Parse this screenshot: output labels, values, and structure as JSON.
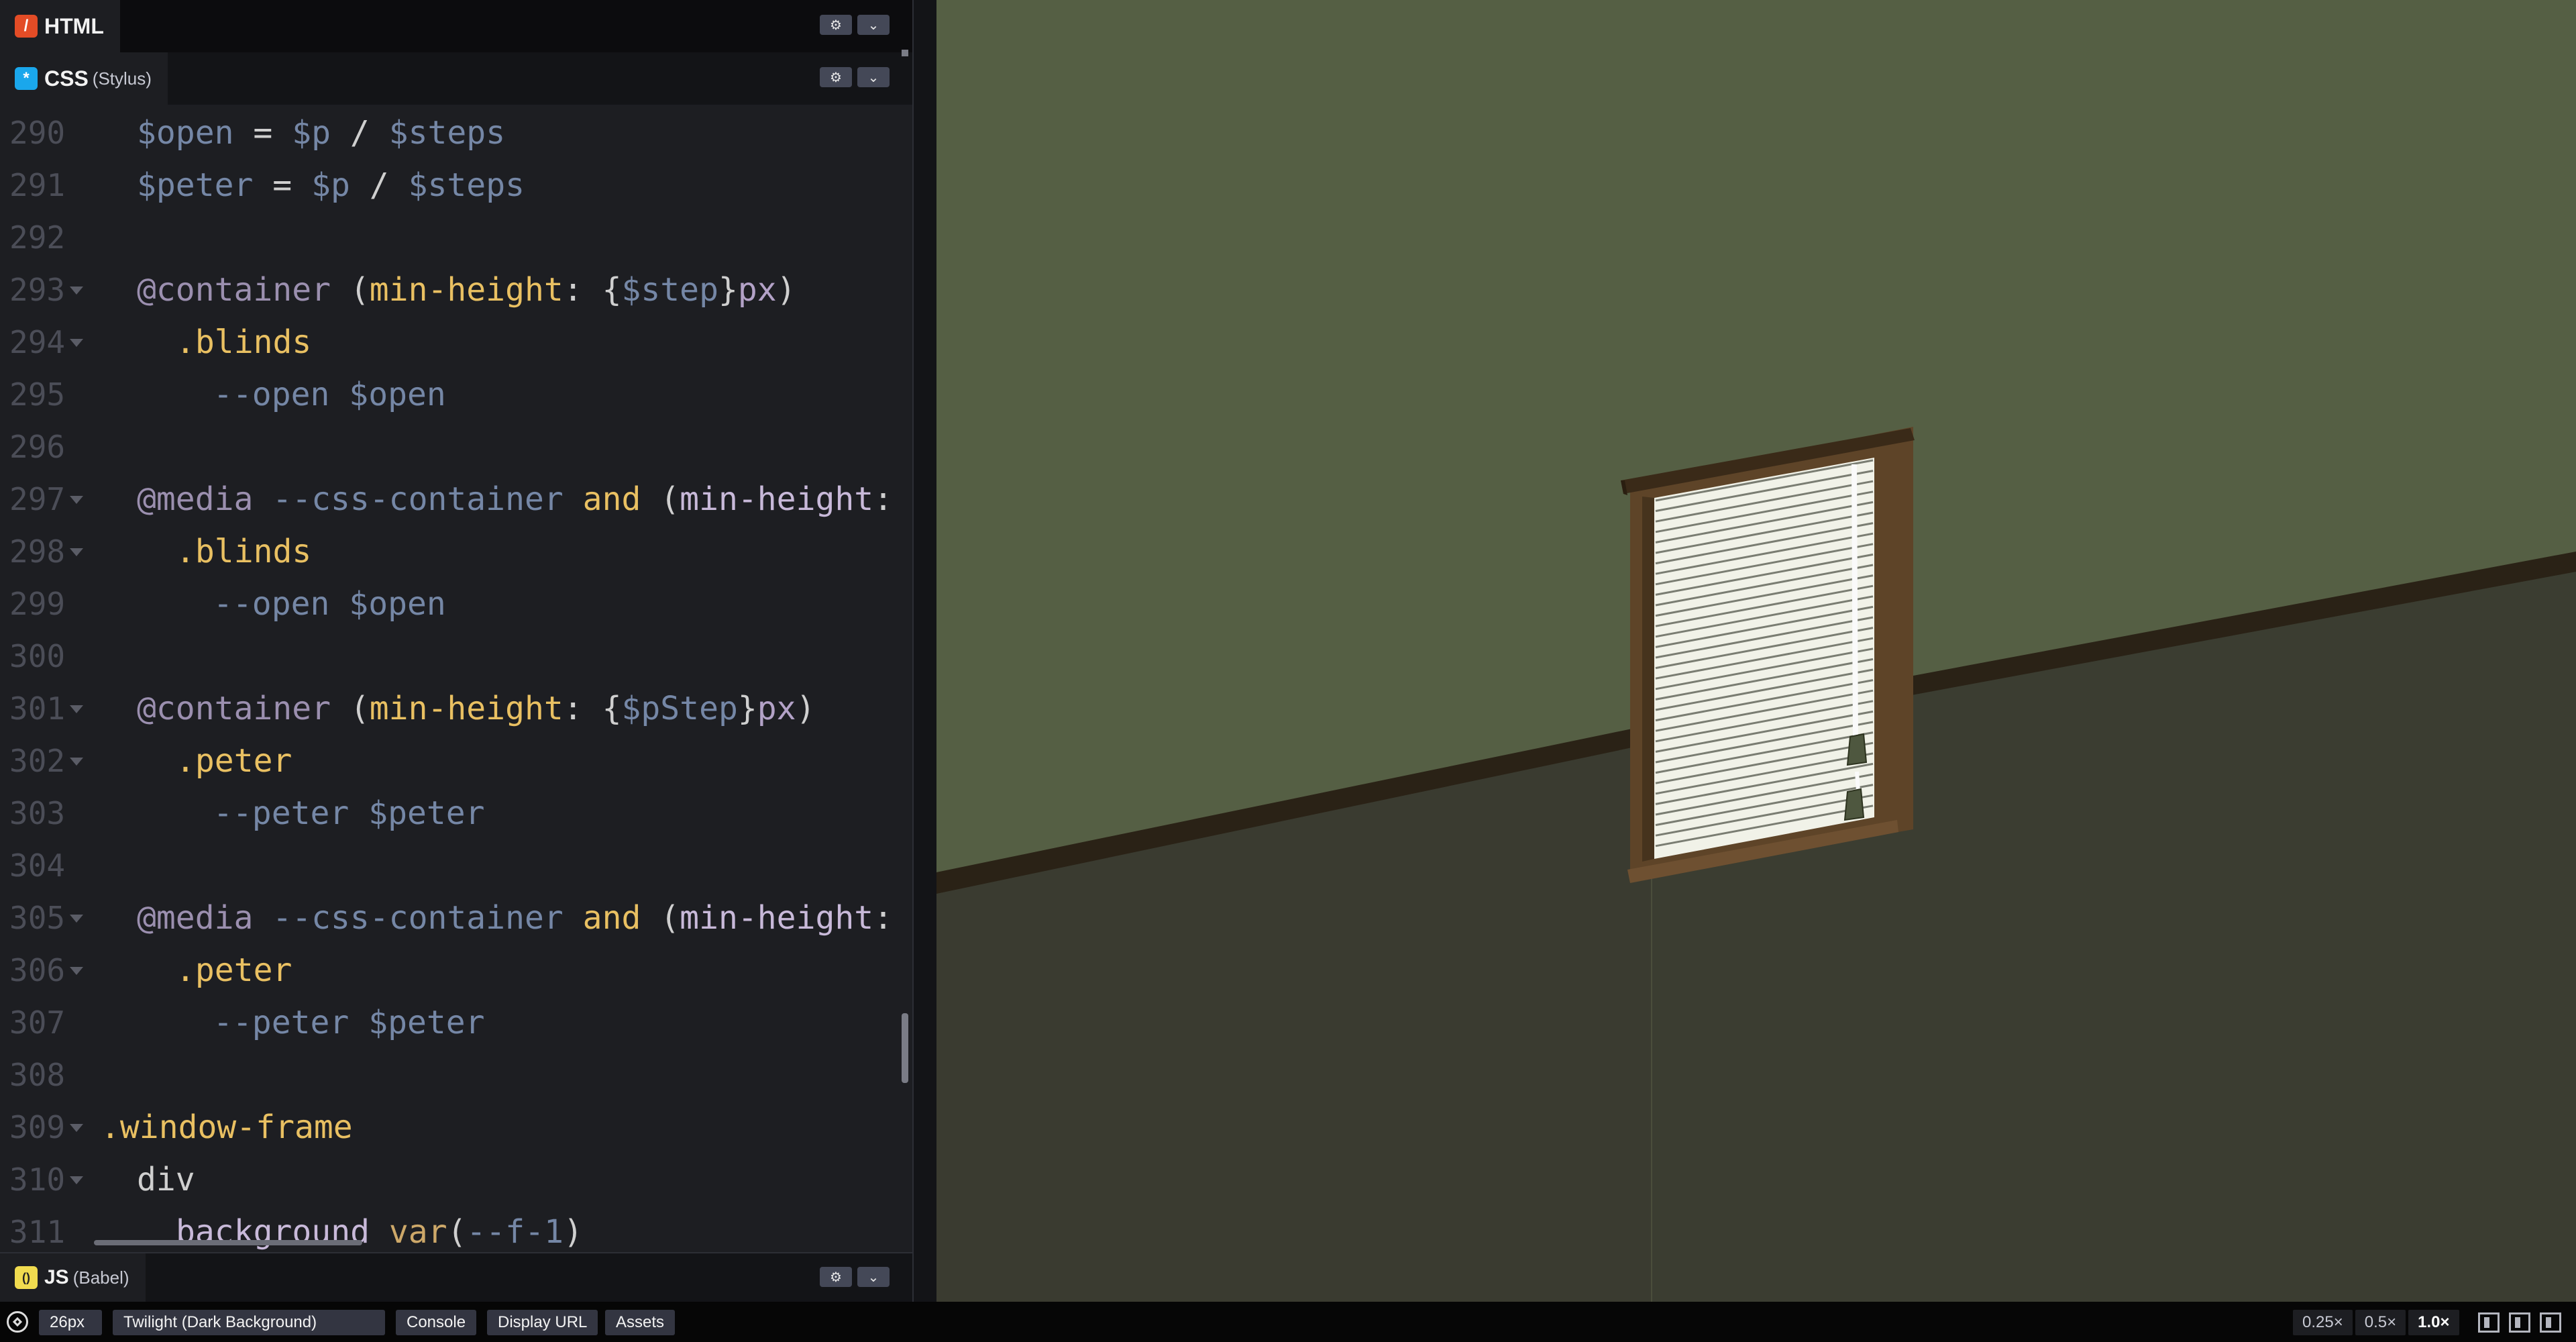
{
  "editors": {
    "html": {
      "badge": "/",
      "label": "HTML",
      "preprocessor": ""
    },
    "css": {
      "badge": "*",
      "label": "CSS",
      "preprocessor": "(Stylus)"
    },
    "js": {
      "badge": "()",
      "label": "JS",
      "preprocessor": "(Babel)"
    }
  },
  "code_lines": [
    {
      "n": "290",
      "fold": false,
      "indent": 1,
      "tokens": [
        [
          "$open",
          "var"
        ],
        [
          " = ",
          "op"
        ],
        [
          "$p",
          "var"
        ],
        [
          " / ",
          "op"
        ],
        [
          "$steps",
          "var"
        ]
      ]
    },
    {
      "n": "291",
      "fold": false,
      "indent": 1,
      "tokens": [
        [
          "$peter",
          "var"
        ],
        [
          " = ",
          "op"
        ],
        [
          "$p",
          "var"
        ],
        [
          " / ",
          "op"
        ],
        [
          "$steps",
          "var"
        ]
      ]
    },
    {
      "n": "292",
      "fold": false,
      "indent": 0,
      "tokens": []
    },
    {
      "n": "293",
      "fold": true,
      "indent": 1,
      "tokens": [
        [
          "@container",
          "at"
        ],
        [
          " (",
          "punc"
        ],
        [
          "min-height",
          "kw"
        ],
        [
          ": {",
          "punc"
        ],
        [
          "$step",
          "var"
        ],
        [
          "}",
          "punc"
        ],
        [
          "px",
          "unit"
        ],
        [
          ")",
          "punc"
        ]
      ]
    },
    {
      "n": "294",
      "fold": true,
      "indent": 2,
      "tokens": [
        [
          ".blinds",
          "sel"
        ]
      ]
    },
    {
      "n": "295",
      "fold": false,
      "indent": 3,
      "tokens": [
        [
          "--open ",
          "var"
        ],
        [
          "$open",
          "var"
        ]
      ]
    },
    {
      "n": "296",
      "fold": false,
      "indent": 0,
      "tokens": []
    },
    {
      "n": "297",
      "fold": true,
      "indent": 1,
      "tokens": [
        [
          "@media",
          "at"
        ],
        [
          " --css-container ",
          "var"
        ],
        [
          "and",
          "kw"
        ],
        [
          " (",
          "punc"
        ],
        [
          "min-height",
          "prop"
        ],
        [
          ": $",
          "punc"
        ]
      ]
    },
    {
      "n": "298",
      "fold": true,
      "indent": 2,
      "tokens": [
        [
          ".blinds",
          "sel"
        ]
      ]
    },
    {
      "n": "299",
      "fold": false,
      "indent": 3,
      "tokens": [
        [
          "--open ",
          "var"
        ],
        [
          "$open",
          "var"
        ]
      ]
    },
    {
      "n": "300",
      "fold": false,
      "indent": 0,
      "tokens": []
    },
    {
      "n": "301",
      "fold": true,
      "indent": 1,
      "tokens": [
        [
          "@container",
          "at"
        ],
        [
          " (",
          "punc"
        ],
        [
          "min-height",
          "kw"
        ],
        [
          ": {",
          "punc"
        ],
        [
          "$pStep",
          "var"
        ],
        [
          "}",
          "punc"
        ],
        [
          "px",
          "unit"
        ],
        [
          ")",
          "punc"
        ]
      ]
    },
    {
      "n": "302",
      "fold": true,
      "indent": 2,
      "tokens": [
        [
          ".peter",
          "sel"
        ]
      ]
    },
    {
      "n": "303",
      "fold": false,
      "indent": 3,
      "tokens": [
        [
          "--peter ",
          "var"
        ],
        [
          "$peter",
          "var"
        ]
      ]
    },
    {
      "n": "304",
      "fold": false,
      "indent": 0,
      "tokens": []
    },
    {
      "n": "305",
      "fold": true,
      "indent": 1,
      "tokens": [
        [
          "@media",
          "at"
        ],
        [
          " --css-container ",
          "var"
        ],
        [
          "and",
          "kw"
        ],
        [
          " (",
          "punc"
        ],
        [
          "min-height",
          "prop"
        ],
        [
          ": $",
          "punc"
        ]
      ]
    },
    {
      "n": "306",
      "fold": true,
      "indent": 2,
      "tokens": [
        [
          ".peter",
          "sel"
        ]
      ]
    },
    {
      "n": "307",
      "fold": false,
      "indent": 3,
      "tokens": [
        [
          "--peter ",
          "var"
        ],
        [
          "$peter",
          "var"
        ]
      ]
    },
    {
      "n": "308",
      "fold": false,
      "indent": 0,
      "tokens": []
    },
    {
      "n": "309",
      "fold": true,
      "indent": 0,
      "tokens": [
        [
          ".window-frame",
          "sel"
        ]
      ]
    },
    {
      "n": "310",
      "fold": true,
      "indent": 1,
      "tokens": [
        [
          "div",
          "op"
        ]
      ]
    },
    {
      "n": "311",
      "fold": false,
      "indent": 2,
      "tokens": [
        [
          "background ",
          "prop"
        ],
        [
          "var",
          "fn"
        ],
        [
          "(",
          "punc"
        ],
        [
          "--f-1",
          "var"
        ],
        [
          ")",
          "punc"
        ]
      ]
    }
  ],
  "footer": {
    "font_size": "26px",
    "theme": "Twilight (Dark Background)",
    "console": "Console",
    "display_url": "Display URL",
    "assets": "Assets",
    "zoom": [
      "0.25×",
      "0.5×",
      "1.0×"
    ],
    "zoom_active": "1.0×"
  },
  "colors": {
    "html_badge": "#e34c26",
    "css_badge": "#1aa7ec",
    "js_badge": "#f0db4f",
    "wall_top": "#555f44",
    "wall_bottom": "#3a3b30",
    "frame": "#6a4c2d"
  },
  "icons": {
    "settings": "gear-icon",
    "collapse": "chevron-down-icon",
    "logo": "codepen-logo-icon",
    "layouts": [
      "layout-left-icon",
      "layout-top-icon",
      "layout-right-icon"
    ]
  }
}
